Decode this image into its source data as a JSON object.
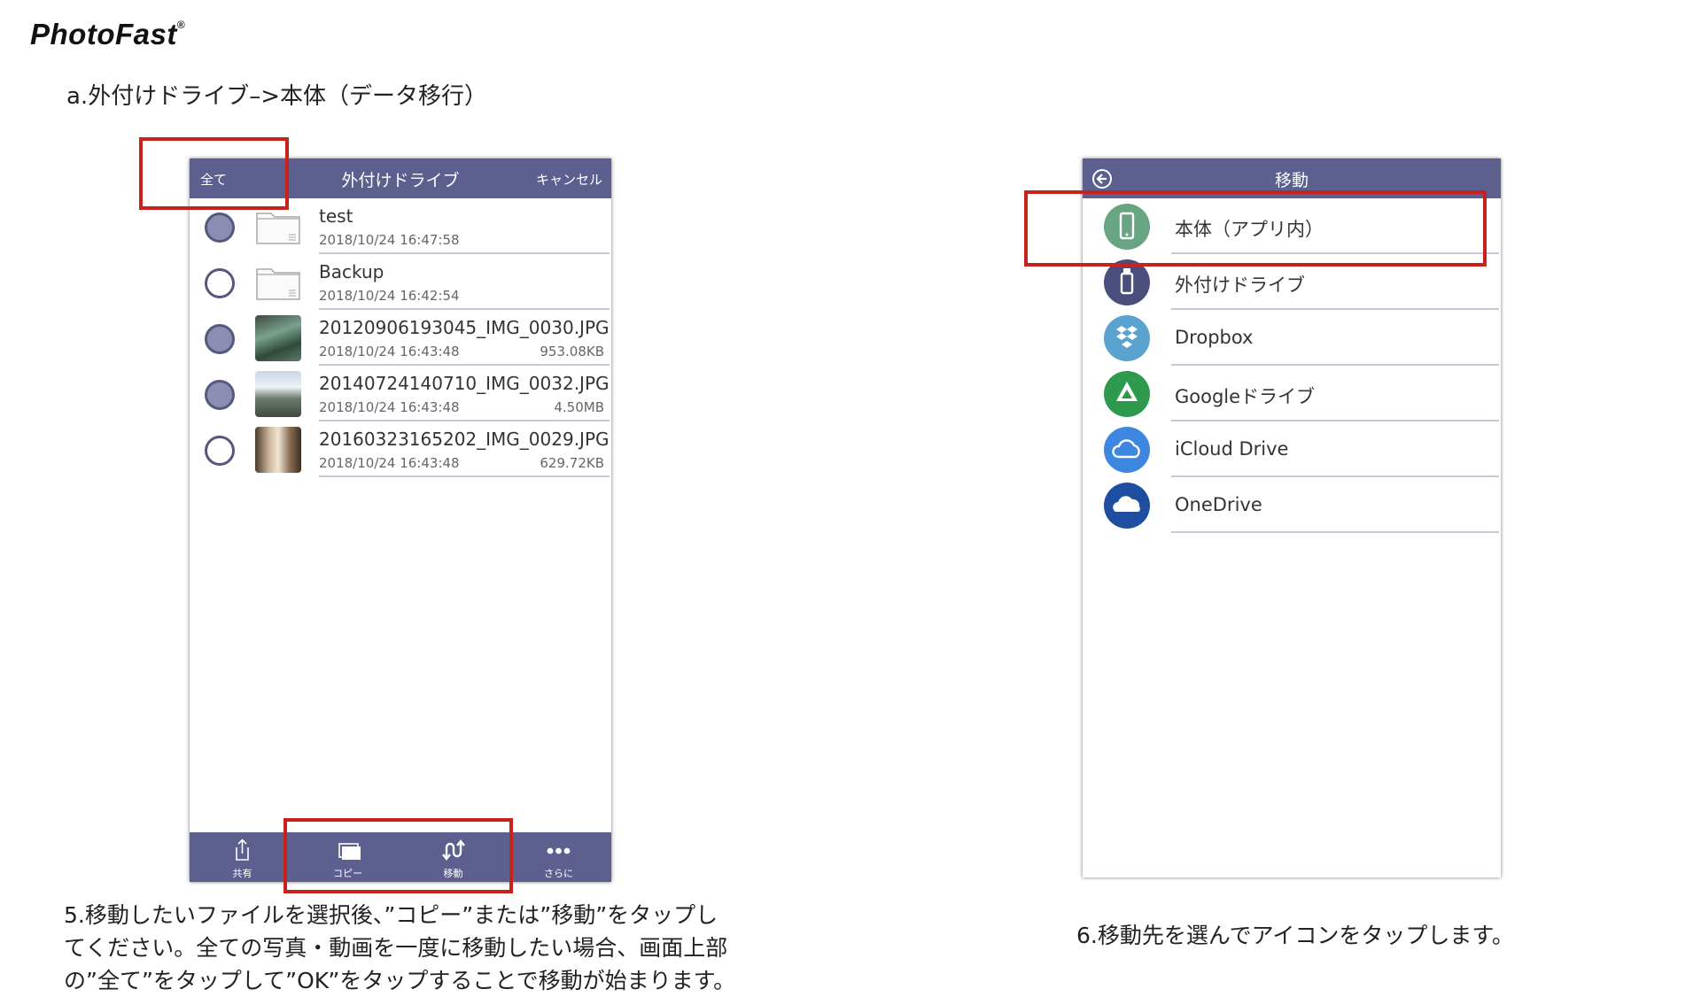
{
  "header": {
    "logo_text": "PhotoFast",
    "logo_mark": "®",
    "section_title": "a.外付けドライブ–>本体（データ移行）"
  },
  "screen1": {
    "topbar": {
      "select_all": "全て",
      "title": "外付けドライブ",
      "cancel": "キャンセル"
    },
    "files": [
      {
        "name": "test",
        "date": "2018/10/24 16:47:58",
        "size": "",
        "type": "folder",
        "selected": true
      },
      {
        "name": "Backup",
        "date": "2018/10/24 16:42:54",
        "size": "",
        "type": "folder",
        "selected": false
      },
      {
        "name": "20120906193045_IMG_0030.JPG",
        "date": "2018/10/24 16:43:48",
        "size": "953.08KB",
        "type": "image",
        "selected": true
      },
      {
        "name": "20140724140710_IMG_0032.JPG",
        "date": "2018/10/24 16:43:48",
        "size": "4.50MB",
        "type": "image",
        "selected": true
      },
      {
        "name": "20160323165202_IMG_0029.JPG",
        "date": "2018/10/24 16:43:48",
        "size": "629.72KB",
        "type": "image",
        "selected": false
      }
    ],
    "toolbar": [
      {
        "label": "共有",
        "icon": "share-icon"
      },
      {
        "label": "コピー",
        "icon": "copy-icon"
      },
      {
        "label": "移動",
        "icon": "move-icon"
      },
      {
        "label": "さらに",
        "icon": "more-icon"
      }
    ],
    "colors": {
      "bar": "#5d5f8f",
      "highlight": "#c8221c"
    }
  },
  "screen2": {
    "topbar": {
      "title": "移動",
      "back_icon": "back-arrow-icon"
    },
    "destinations": [
      {
        "label": "本体（アプリ内）",
        "icon": "phone-icon",
        "color": "#6aa583"
      },
      {
        "label": "外付けドライブ",
        "icon": "usb-drive-icon",
        "color": "#4b4d7d"
      },
      {
        "label": "Dropbox",
        "icon": "dropbox-icon",
        "color": "#5aa3cf"
      },
      {
        "label": "Googleドライブ",
        "icon": "google-drive-icon",
        "color": "#2e9a4e"
      },
      {
        "label": "iCloud Drive",
        "icon": "icloud-icon",
        "color": "#3e87e0"
      },
      {
        "label": "OneDrive",
        "icon": "onedrive-icon",
        "color": "#1d4ea0"
      }
    ]
  },
  "captions": {
    "step5": [
      "5.移動したいファイルを選択後、”コピー”または”移動”をタップし",
      "てください。全ての写真・動画を一度に移動したい場合、画面上部",
      "の”全て”をタップして”OK”をタップすることで移動が始まります。"
    ],
    "step6": "6.移動先を選んでアイコンをタップします。"
  }
}
